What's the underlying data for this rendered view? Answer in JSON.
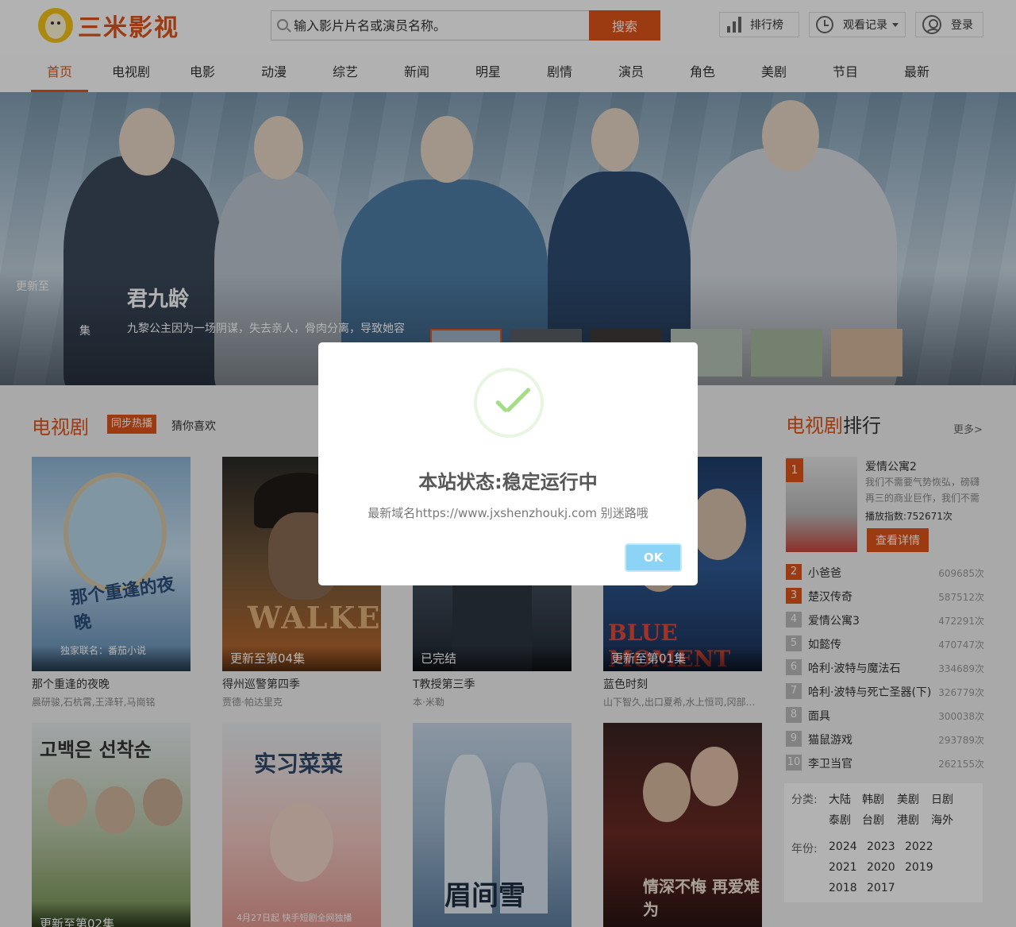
{
  "header": {
    "logo_text": "三米影视",
    "search_placeholder": "输入影片片名或演员名称。",
    "search_button": "搜索",
    "rank_button": "排行榜",
    "history_button": "观看记录",
    "login_button": "登录"
  },
  "nav": [
    "首页",
    "电视剧",
    "电影",
    "动漫",
    "综艺",
    "新闻",
    "明星",
    "剧情",
    "演员",
    "角色",
    "美剧",
    "节目",
    "最新"
  ],
  "banner": {
    "update_label": "更新至",
    "episode_label": "集",
    "title": "君九龄",
    "desc": "九黎公主因为一场阴谋，失去亲人，骨肉分离，导致她容"
  },
  "tv_section": {
    "title": "电视剧",
    "tag_hot": "同步热播",
    "tag_guess": "猜你喜欢"
  },
  "cards": [
    {
      "title": "那个重逢的夜晚",
      "actors": "晨研骏,石杭霄,王泽轩,马崗铭",
      "label": "",
      "art": "那个重逢的夜晚"
    },
    {
      "title": "得州巡警第四季",
      "actors": "贾德·帕达里克",
      "label": "更新至第04集",
      "art": "WALKER"
    },
    {
      "title": "T教授第三季",
      "actors": "本·米勒",
      "label": "已完结",
      "art": ""
    },
    {
      "title": "蓝色时刻",
      "actors": "山下智久,出口夏希,水上恒司,冈部大...",
      "label": "更新至第01集",
      "art": "BLUE MOMENT"
    },
    {
      "title": "",
      "actors": "",
      "label": "更新至第02集",
      "art": "고백은 선착순"
    },
    {
      "title": "",
      "actors": "",
      "label": "",
      "art": "实习菜菜"
    },
    {
      "title": "",
      "actors": "",
      "label": "",
      "art": "眉间雪"
    },
    {
      "title": "",
      "actors": "",
      "label": "",
      "art": "情深不悔 再爱难为"
    }
  ],
  "poster_extra": {
    "card0_tag": "独家联名：番茄小说",
    "card5_date": "4月27日起 快手短剧全网独播"
  },
  "ranking": {
    "title_highlight": "电视剧",
    "title_rest": "排行",
    "more": "更多>",
    "top": {
      "num": "1",
      "name": "爱情公寓2",
      "desc": "我们不需要气势恢弘，磅礴再三的商业巨作，我们不需",
      "count": "播放指数:752671次",
      "button": "查看详情"
    },
    "items": [
      {
        "num": "2",
        "name": "小爸爸",
        "count": "609685次"
      },
      {
        "num": "3",
        "name": "楚汉传奇",
        "count": "587512次"
      },
      {
        "num": "4",
        "name": "爱情公寓3",
        "count": "472291次"
      },
      {
        "num": "5",
        "name": "如懿传",
        "count": "470747次"
      },
      {
        "num": "6",
        "name": "哈利·波特与魔法石",
        "count": "334689次"
      },
      {
        "num": "7",
        "name": "哈利·波特与死亡圣器(下)",
        "count": "326779次"
      },
      {
        "num": "8",
        "name": "面具",
        "count": "300038次"
      },
      {
        "num": "9",
        "name": "猫鼠游戏",
        "count": "293789次"
      },
      {
        "num": "10",
        "name": "李卫当官",
        "count": "262155次"
      }
    ]
  },
  "filters": {
    "category_label": "分类:",
    "categories": [
      "大陆",
      "韩剧",
      "美剧",
      "日剧",
      "泰剧",
      "台剧",
      "港剧",
      "海外"
    ],
    "year_label": "年份:",
    "years": [
      "2024",
      "2023",
      "2022",
      "2021",
      "2020",
      "2019",
      "2018",
      "2017"
    ]
  },
  "modal": {
    "title": "本站状态:稳定运行中",
    "text": "最新域名https://www.jxshenzhoukj.com 别迷路哦",
    "ok": "OK"
  },
  "colors": {
    "accent": "#e0551b",
    "ok_button": "#8cd4f5",
    "check": "#a5dc86"
  }
}
